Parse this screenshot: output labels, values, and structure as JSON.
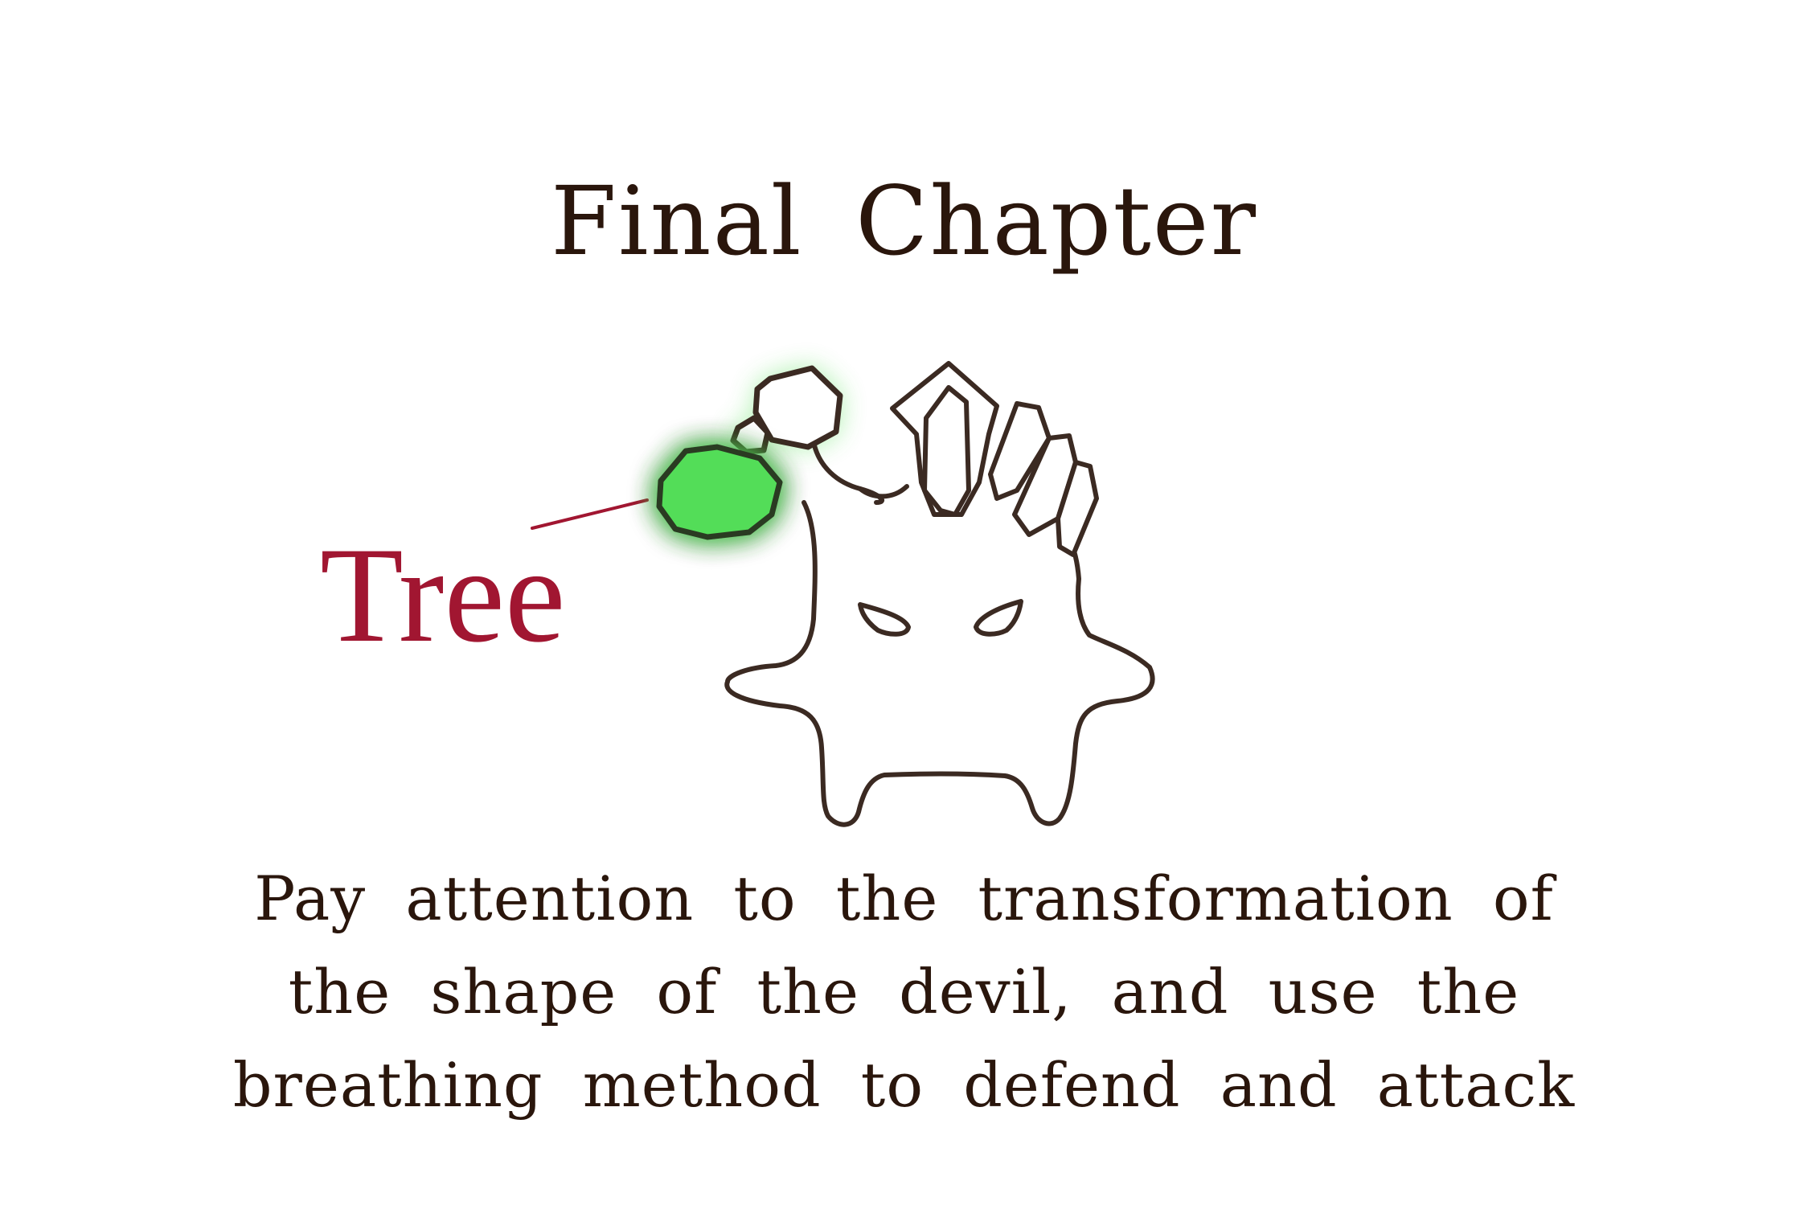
{
  "chapter": {
    "title": "Final Chapter"
  },
  "devil": {
    "highlighted_part_label": "Tree",
    "highlight_color": "#52dd59",
    "label_color": "#a11631",
    "outline_color": "#3b2a22"
  },
  "hint": {
    "lines": [
      "Pay attention to the transformation of",
      "the shape of the devil, and use the",
      "breathing method to defend and attack"
    ]
  }
}
